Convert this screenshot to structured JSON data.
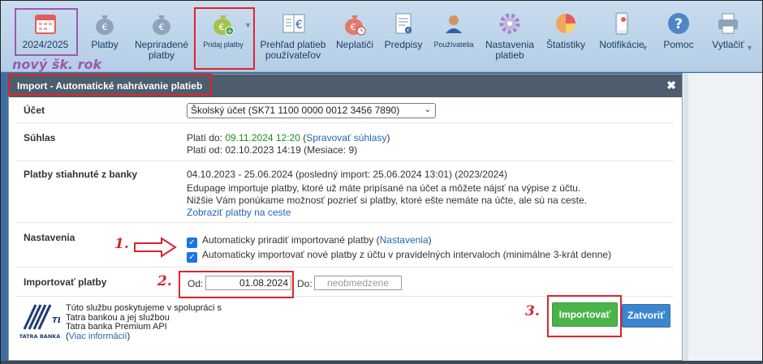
{
  "toolbar": {
    "items": [
      {
        "label": "2024/2025",
        "icon": "calendar-icon"
      },
      {
        "label": "Platby",
        "icon": "money-bag-icon"
      },
      {
        "label": "Nepriradené platby",
        "icon": "money-bag-icon"
      },
      {
        "label": "Pridaj platby",
        "icon": "money-bag-add-icon"
      },
      {
        "label": "Prehľad platieb používateľov",
        "icon": "ledger-icon"
      },
      {
        "label": "Neplatiči",
        "icon": "money-bag-clock-icon"
      },
      {
        "label": "Predpisy",
        "icon": "document-icon"
      },
      {
        "label": "Používatelia",
        "icon": "user-icon"
      },
      {
        "label": "Nastavenia platieb",
        "icon": "gear-icon"
      },
      {
        "label": "Štatistiky",
        "icon": "pie-chart-icon"
      },
      {
        "label": "Notifikácie",
        "icon": "phone-icon"
      },
      {
        "label": "Pomoc",
        "icon": "help-icon"
      },
      {
        "label": "Vytlačiť",
        "icon": "printer-icon"
      }
    ]
  },
  "annotations": {
    "new_year": "nový šk. rok",
    "step1": "1.",
    "step2": "2.",
    "step3": "3."
  },
  "dialog": {
    "title": "Import - Automatické nahrávanie platieb",
    "close_icon": "close-icon",
    "account_label": "Účet",
    "account_value": "Školský účet (SK71 1100 0000 0012 3456 7890)",
    "consent_label": "Súhlas",
    "consent_valid_to_prefix": "Platí do:",
    "consent_valid_to": "09.11.2024 12:20",
    "consent_manage_link": "Spravovať súhlasy",
    "consent_valid_from": "Platí od: 02.10.2023 14:19 (Mesiace: 9)",
    "downloaded_label": "Platby stiahnuté z banky",
    "downloaded_range": "04.10.2023 - 25.06.2024 (posledný import: 25.06.2024 13:01) (2023/2024)",
    "downloaded_info1": "Edupage importuje platby, ktoré už máte pripísané na účet a môžete nájsť na výpise z účtu.",
    "downloaded_info2": "Nižšie Vám ponúkame možnosť pozrieť si platby, ktoré ešte nemáte na účte, ale sú na ceste.",
    "downloaded_link": "Zobraziť platby na ceste",
    "settings_label": "Nastavenia",
    "settings_cb1": "Automaticky priradiť importované platby",
    "settings_cb1_link": "Nastavenia",
    "settings_cb2": "Automaticky importovať nové platby z účtu v pravidelných intervaloch (minimálne 3-krát denne)",
    "import_label": "Importovať platby",
    "from_label": "Od:",
    "from_value": "01.08.2024",
    "to_label": "Do:",
    "to_placeholder": "neobmedzene",
    "footer_line1": "Túto službu poskytujeme v spolupráci s",
    "footer_line2": "Tatra bankou a jej službou",
    "footer_line3": "Tatra banka Premium API",
    "footer_link": "Viac informácií",
    "logo_text": "TATRA BANKA",
    "import_button": "Importovať",
    "close_button": "Zatvoriť"
  }
}
